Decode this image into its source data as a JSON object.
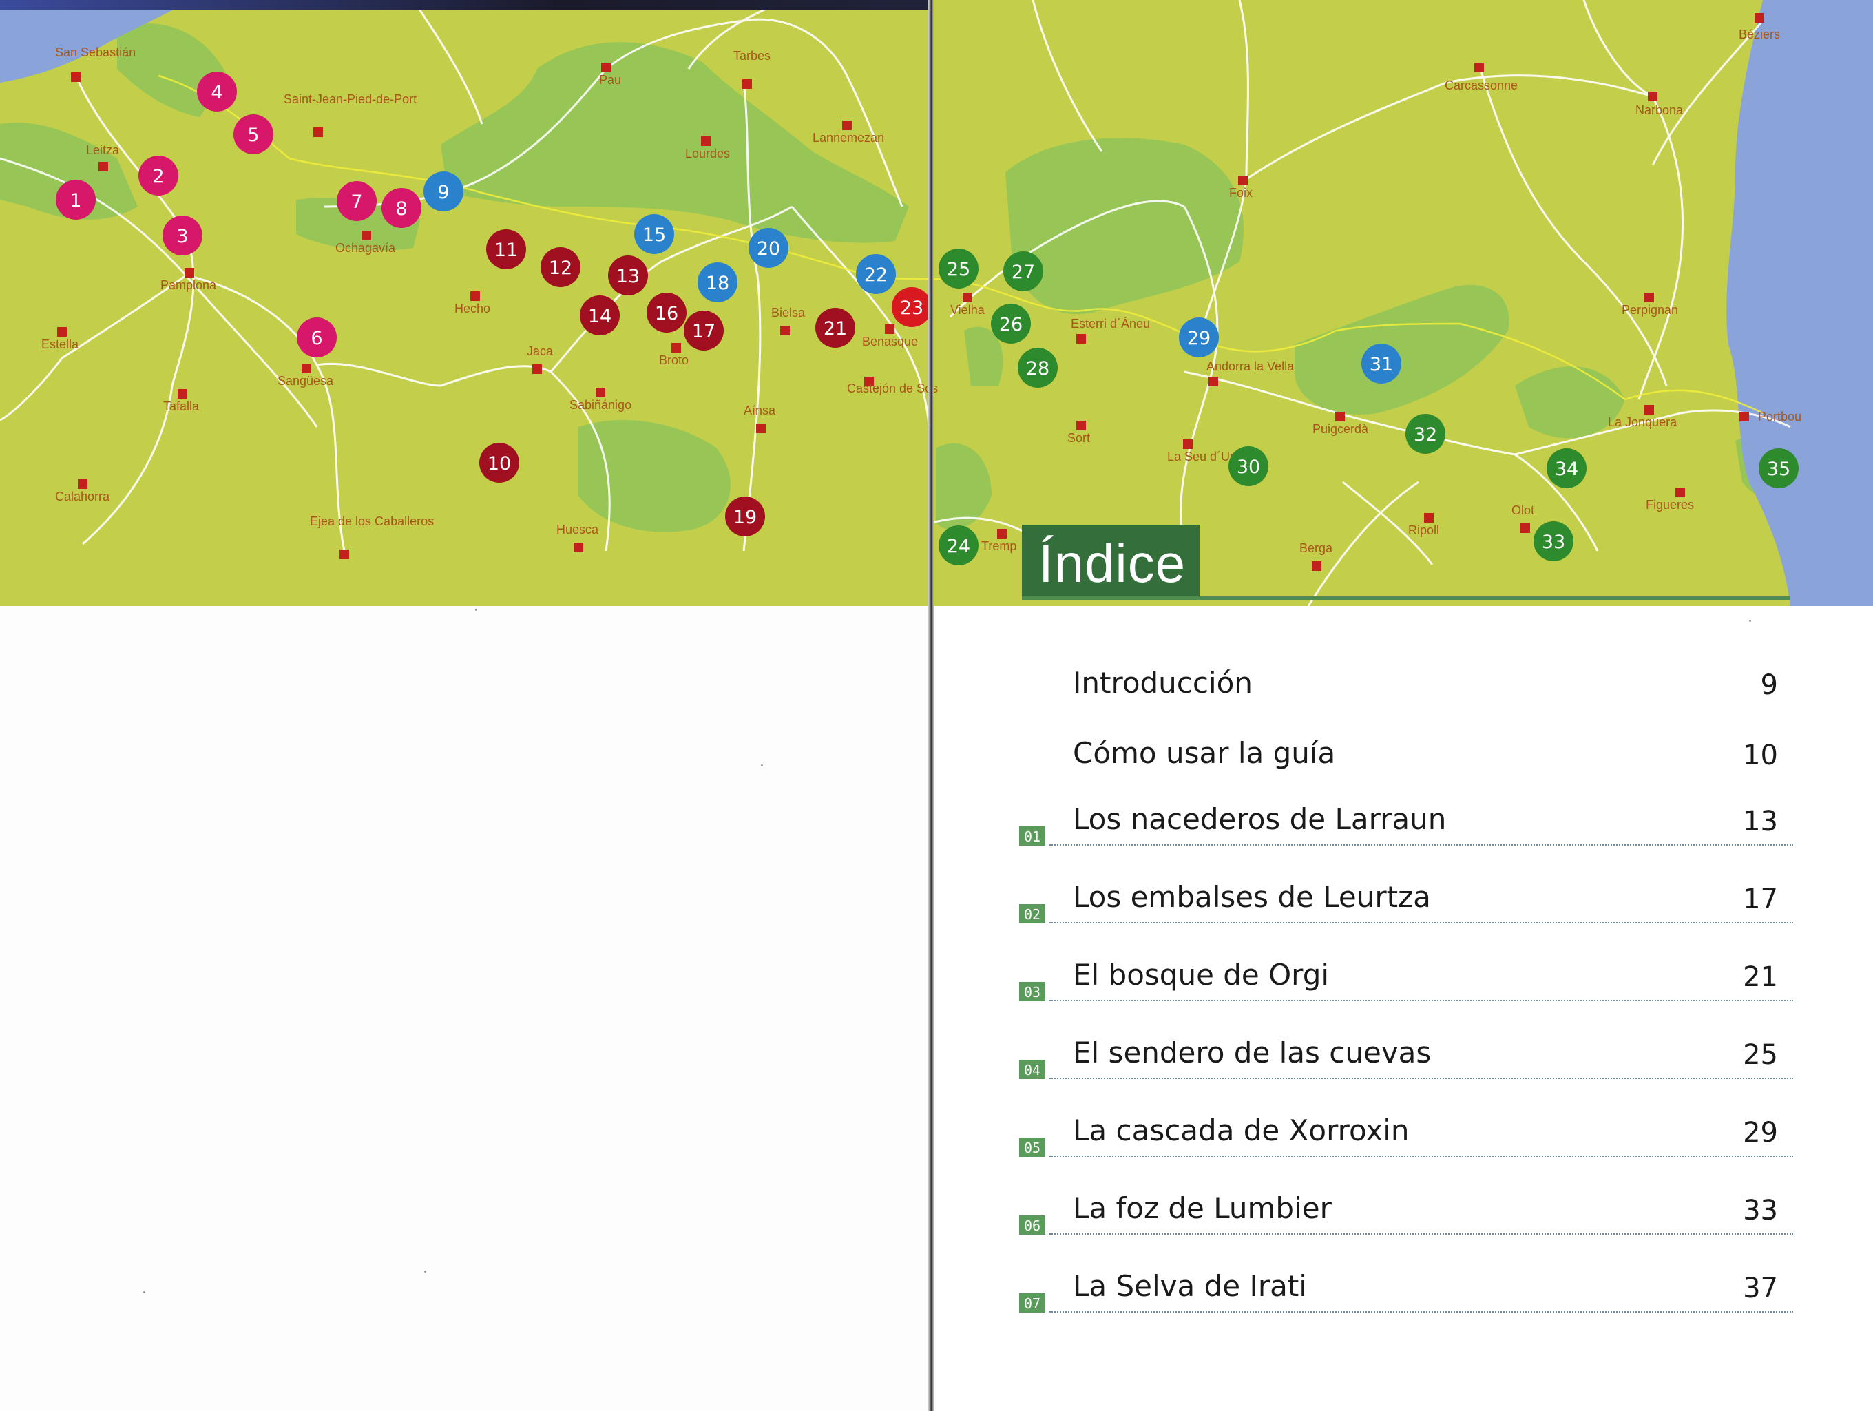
{
  "colors": {
    "pink": "#d6176a",
    "darkred": "#a01020",
    "red": "#d81a20",
    "blue": "#2b82cc",
    "green": "#2d8a2d",
    "land": "#c3cf4a",
    "highland": "#98c656",
    "sea": "#8aa3d8",
    "road": "#ffffff",
    "town": "#c2211c",
    "index_green": "#336e3b"
  },
  "map": {
    "markers": [
      {
        "n": "1",
        "color": "pink"
      },
      {
        "n": "2",
        "color": "pink"
      },
      {
        "n": "3",
        "color": "pink"
      },
      {
        "n": "4",
        "color": "pink"
      },
      {
        "n": "5",
        "color": "pink"
      },
      {
        "n": "6",
        "color": "pink"
      },
      {
        "n": "7",
        "color": "pink"
      },
      {
        "n": "8",
        "color": "pink"
      },
      {
        "n": "9",
        "color": "blue"
      },
      {
        "n": "10",
        "color": "darkred"
      },
      {
        "n": "11",
        "color": "darkred"
      },
      {
        "n": "12",
        "color": "darkred"
      },
      {
        "n": "13",
        "color": "darkred"
      },
      {
        "n": "14",
        "color": "darkred"
      },
      {
        "n": "15",
        "color": "blue"
      },
      {
        "n": "16",
        "color": "darkred"
      },
      {
        "n": "17",
        "color": "darkred"
      },
      {
        "n": "18",
        "color": "blue"
      },
      {
        "n": "19",
        "color": "darkred"
      },
      {
        "n": "20",
        "color": "blue"
      },
      {
        "n": "21",
        "color": "darkred"
      },
      {
        "n": "22",
        "color": "blue"
      },
      {
        "n": "23",
        "color": "red"
      },
      {
        "n": "24",
        "color": "green"
      },
      {
        "n": "25",
        "color": "green"
      },
      {
        "n": "26",
        "color": "green"
      },
      {
        "n": "27",
        "color": "green"
      },
      {
        "n": "28",
        "color": "green"
      },
      {
        "n": "29",
        "color": "blue"
      },
      {
        "n": "30",
        "color": "green"
      },
      {
        "n": "31",
        "color": "blue"
      },
      {
        "n": "32",
        "color": "green"
      },
      {
        "n": "33",
        "color": "green"
      },
      {
        "n": "34",
        "color": "green"
      },
      {
        "n": "35",
        "color": "green"
      }
    ],
    "towns": [
      "San Sebastián",
      "Leitza",
      "Pamplona",
      "Estella",
      "Tafalla",
      "Calahorra",
      "Saint-Jean-Pied-de-Port",
      "Ochagavía",
      "Sangüesa",
      "Ejea de los Caballeros",
      "Pau",
      "Tarbes",
      "Lourdes",
      "Lannemezan",
      "Hecho",
      "Jaca",
      "Sabiñánigo",
      "Broto",
      "Bielsa",
      "Aínsa",
      "Huesca",
      "Benasque",
      "Castejón de Sos",
      "Vielha",
      "Tremp",
      "Esterri d´Àneu",
      "Sort",
      "Andorra la Vella",
      "La Seu d´Urgell",
      "Foix",
      "Carcassonne",
      "Puigcerdà",
      "Berga",
      "Ripoll",
      "Olot",
      "La Jonquera",
      "Figueres",
      "Portbou",
      "Perpignan",
      "Narbona",
      "Béziers"
    ]
  },
  "index": {
    "title": "Índice",
    "items": [
      {
        "num": "",
        "title": "Introducción",
        "page": "9"
      },
      {
        "num": "",
        "title": "Cómo usar la guía",
        "page": "10"
      },
      {
        "num": "01",
        "title": "Los nacederos de Larraun",
        "page": "13"
      },
      {
        "num": "02",
        "title": "Los embalses de Leurtza",
        "page": "17"
      },
      {
        "num": "03",
        "title": "El bosque de Orgi",
        "page": "21"
      },
      {
        "num": "04",
        "title": "El sendero de las cuevas",
        "page": "25"
      },
      {
        "num": "05",
        "title": "La cascada de Xorroxin",
        "page": "29"
      },
      {
        "num": "06",
        "title": "La foz de Lumbier",
        "page": "33"
      },
      {
        "num": "07",
        "title": "La Selva de Irati",
        "page": "37"
      }
    ]
  }
}
